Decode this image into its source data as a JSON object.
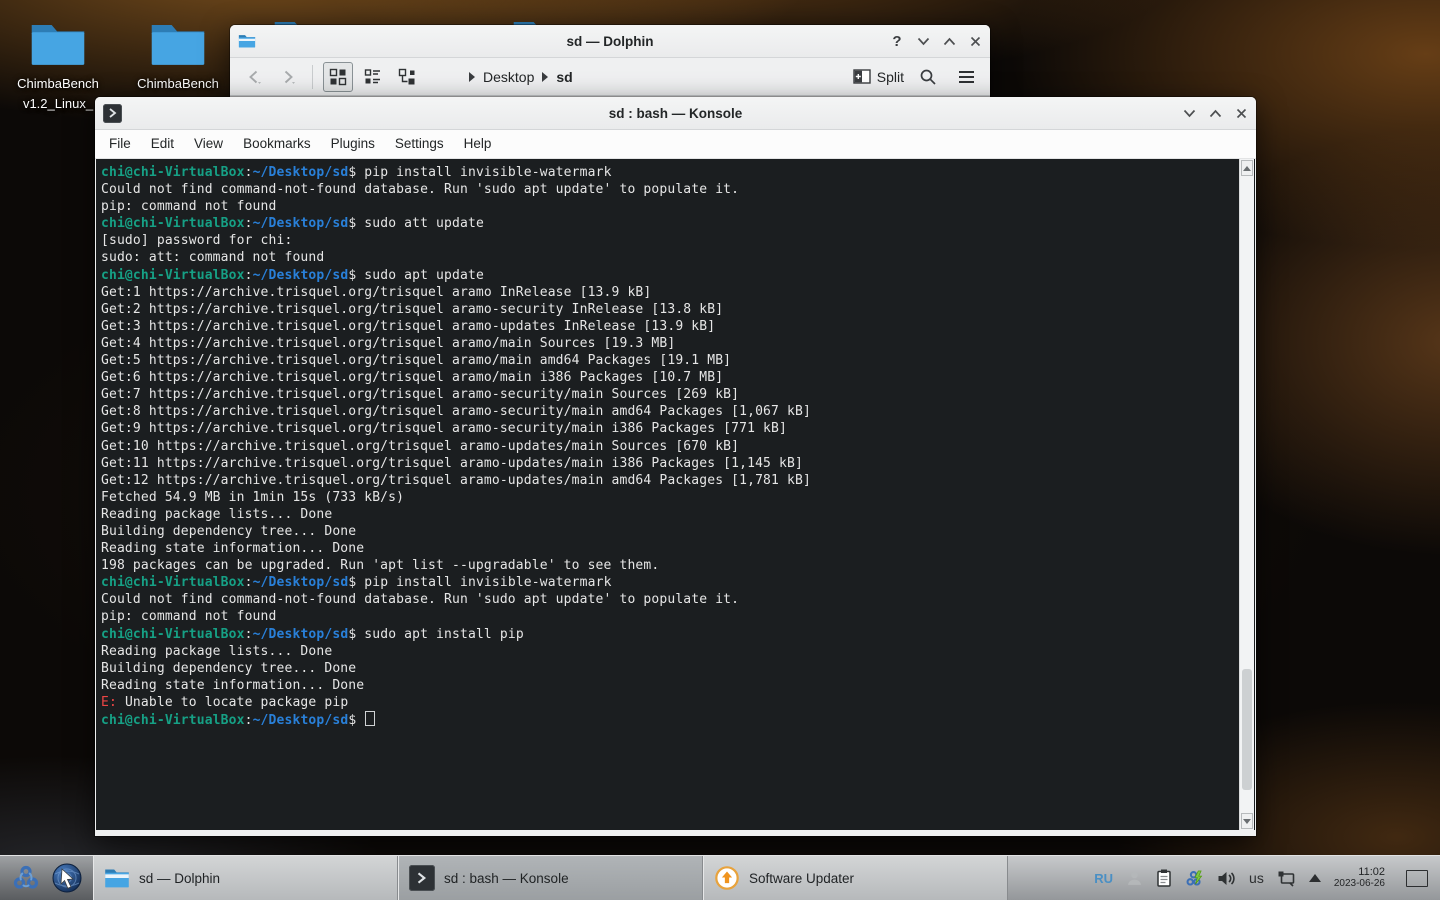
{
  "desktop": {
    "icons": [
      {
        "label_lines": [
          "ChimbaBench",
          "v1.2_Linux_"
        ]
      },
      {
        "label_lines": [
          "ChimbaBench"
        ]
      }
    ]
  },
  "dolphin": {
    "title": "sd — Dolphin",
    "help_label": "?",
    "breadcrumb": {
      "root": "Desktop",
      "current": "sd"
    },
    "split_label": "Split"
  },
  "konsole": {
    "title": "sd : bash — Konsole",
    "menu": [
      "File",
      "Edit",
      "View",
      "Bookmarks",
      "Plugins",
      "Settings",
      "Help"
    ],
    "prompt": {
      "user_host": "chi@chi-VirtualBox",
      "path": "~/Desktop/sd",
      "symbol": "$"
    },
    "lines": [
      {
        "t": "p",
        "cmd": "pip install invisible-watermark"
      },
      {
        "t": "o",
        "text": "Could not find command-not-found database. Run 'sudo apt update' to populate it."
      },
      {
        "t": "o",
        "text": "pip: command not found"
      },
      {
        "t": "p",
        "cmd": "sudo att update"
      },
      {
        "t": "o",
        "text": "[sudo] password for chi:"
      },
      {
        "t": "o",
        "text": "sudo: att: command not found"
      },
      {
        "t": "p",
        "cmd": "sudo apt update"
      },
      {
        "t": "o",
        "text": "Get:1 https://archive.trisquel.org/trisquel aramo InRelease [13.9 kB]"
      },
      {
        "t": "o",
        "text": "Get:2 https://archive.trisquel.org/trisquel aramo-security InRelease [13.8 kB]"
      },
      {
        "t": "o",
        "text": "Get:3 https://archive.trisquel.org/trisquel aramo-updates InRelease [13.9 kB]"
      },
      {
        "t": "o",
        "text": "Get:4 https://archive.trisquel.org/trisquel aramo/main Sources [19.3 MB]"
      },
      {
        "t": "o",
        "text": "Get:5 https://archive.trisquel.org/trisquel aramo/main amd64 Packages [19.1 MB]"
      },
      {
        "t": "o",
        "text": "Get:6 https://archive.trisquel.org/trisquel aramo/main i386 Packages [10.7 MB]"
      },
      {
        "t": "o",
        "text": "Get:7 https://archive.trisquel.org/trisquel aramo-security/main Sources [269 kB]"
      },
      {
        "t": "o",
        "text": "Get:8 https://archive.trisquel.org/trisquel aramo-security/main amd64 Packages [1,067 kB]"
      },
      {
        "t": "o",
        "text": "Get:9 https://archive.trisquel.org/trisquel aramo-security/main i386 Packages [771 kB]"
      },
      {
        "t": "o",
        "text": "Get:10 https://archive.trisquel.org/trisquel aramo-updates/main Sources [670 kB]"
      },
      {
        "t": "o",
        "text": "Get:11 https://archive.trisquel.org/trisquel aramo-updates/main i386 Packages [1,145 kB]"
      },
      {
        "t": "o",
        "text": "Get:12 https://archive.trisquel.org/trisquel aramo-updates/main amd64 Packages [1,781 kB]"
      },
      {
        "t": "o",
        "text": "Fetched 54.9 MB in 1min 15s (733 kB/s)"
      },
      {
        "t": "o",
        "text": "Reading package lists... Done"
      },
      {
        "t": "o",
        "text": "Building dependency tree... Done"
      },
      {
        "t": "o",
        "text": "Reading state information... Done"
      },
      {
        "t": "o",
        "text": "198 packages can be upgraded. Run 'apt list --upgradable' to see them."
      },
      {
        "t": "p",
        "cmd": "pip install invisible-watermark"
      },
      {
        "t": "o",
        "text": "Could not find command-not-found database. Run 'sudo apt update' to populate it."
      },
      {
        "t": "o",
        "text": "pip: command not found"
      },
      {
        "t": "p",
        "cmd": "sudo apt install pip"
      },
      {
        "t": "o",
        "text": "Reading package lists... Done"
      },
      {
        "t": "o",
        "text": "Building dependency tree... Done"
      },
      {
        "t": "o",
        "text": "Reading state information... Done"
      },
      {
        "t": "e",
        "prefix": "E:",
        "text": " Unable to locate package pip"
      },
      {
        "t": "p",
        "cmd": "",
        "cursor": true
      }
    ]
  },
  "taskbar": {
    "tasks": [
      {
        "label": "sd — Dolphin"
      },
      {
        "label": "sd : bash — Konsole"
      },
      {
        "label": "Software Updater"
      }
    ],
    "tray": {
      "layout": "RU",
      "keyboard": "us",
      "time": "11:02",
      "date": "2023-06-26"
    }
  },
  "colors": {
    "accent": "#3daee9",
    "terminal_bg": "#1b1e20",
    "terminal_fg": "#e6e6e6",
    "prompt_user": "#16a085",
    "prompt_path": "#2980d9",
    "error_red": "#ed4545"
  }
}
